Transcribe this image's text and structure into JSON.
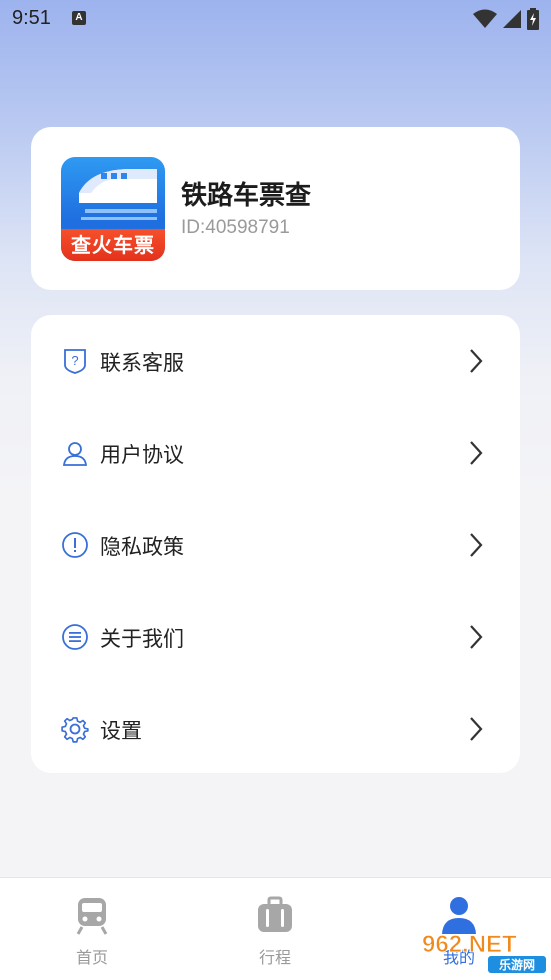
{
  "status_bar": {
    "time": "9:51",
    "notification_icon": "A",
    "icons": [
      "wifi-icon",
      "signal-icon",
      "battery-icon"
    ]
  },
  "profile": {
    "logo_text": "查火车票",
    "app_name": "铁路车票查",
    "user_id": "ID:40598791"
  },
  "menu": {
    "items": [
      {
        "label": "联系客服",
        "icon": "question-shield-icon"
      },
      {
        "label": "用户协议",
        "icon": "user-icon"
      },
      {
        "label": "隐私政策",
        "icon": "exclamation-circle-icon"
      },
      {
        "label": "关于我们",
        "icon": "list-circle-icon"
      },
      {
        "label": "设置",
        "icon": "gear-icon"
      }
    ]
  },
  "bottom_nav": {
    "items": [
      {
        "label": "首页",
        "icon": "train-icon",
        "active": false
      },
      {
        "label": "行程",
        "icon": "luggage-icon",
        "active": false
      },
      {
        "label": "我的",
        "icon": "person-icon",
        "active": true
      }
    ]
  },
  "watermark": {
    "text": "962.NET",
    "subtext": "乐游网"
  },
  "colors": {
    "accent": "#2f6fe0",
    "icon_blue": "#3a6fd8",
    "nav_inactive": "#a7a7a7",
    "logo_band": "#e8391f"
  }
}
